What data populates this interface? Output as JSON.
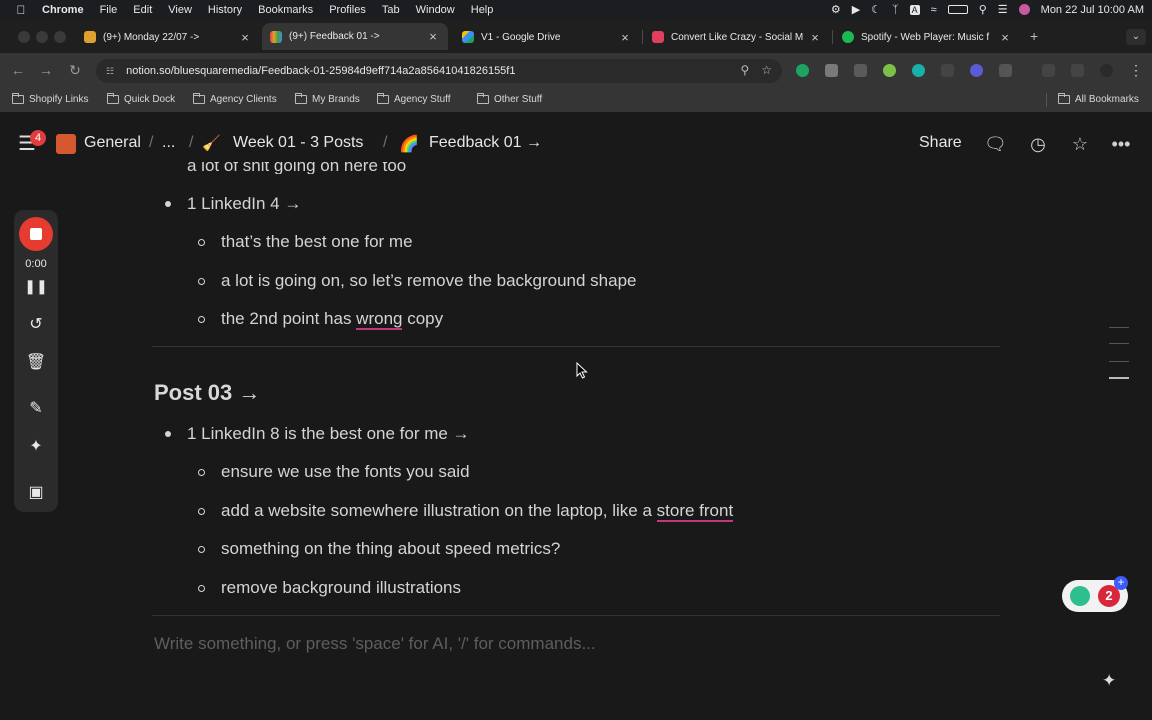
{
  "menubar": {
    "app": "Chrome",
    "items": [
      "File",
      "Edit",
      "View",
      "History",
      "Bookmarks",
      "Profiles",
      "Tab",
      "Window",
      "Help"
    ],
    "clock": "Mon 22 Jul  10:00 AM"
  },
  "tabs": [
    {
      "label": "(9+) Monday 22/07 ->",
      "icon": "trophy-icon",
      "color": "#e0a030"
    },
    {
      "label": "(9+) Feedback 01 ->",
      "icon": "rainbow-icon",
      "color": "#e06040",
      "active": true
    },
    {
      "label": "V1 - Google Drive",
      "icon": "google-drive-icon",
      "color": "#3b8ff0"
    },
    {
      "label": "Convert Like Crazy - Social M",
      "icon": "app-icon",
      "color": "#e04060"
    },
    {
      "label": "Spotify - Web Player: Music f",
      "icon": "spotify-icon",
      "color": "#1db954"
    }
  ],
  "address": {
    "url": "notion.so/bluesquaremedia/Feedback-01-25984d9eff714a2a85641041826155f1"
  },
  "bookmarks": {
    "items": [
      "Shopify Links",
      "Quick Dock",
      "Agency Clients",
      "My Brands",
      "Agency Stuff",
      "Other Stuff"
    ],
    "all": "All Bookmarks"
  },
  "notion": {
    "badge": "4",
    "crumbs": [
      "General",
      "...",
      "Week 01 - 3 Posts",
      "Feedback 01 →"
    ],
    "share": "Share"
  },
  "recorder": {
    "timer": "0:00"
  },
  "content": {
    "cut_line": "a lot of shit going on here too",
    "linkedin4": "1 LinkedIn 4 →",
    "l4_items": [
      {
        "text": "that’s the best one for me"
      },
      {
        "text": "a lot is going on, so let’s remove the background shape"
      },
      {
        "before": "the 2nd point has ",
        "flagged": "wrong",
        "after": " copy"
      }
    ],
    "post03": "Post 03 →",
    "linkedin8": "1 LinkedIn 8 is the best one for me →",
    "l8_items": [
      {
        "text": "ensure we use the fonts you said"
      },
      {
        "before": "add a website somewhere illustration on the laptop, like a ",
        "flagged": "store front"
      },
      {
        "text": "something on the thing about speed metrics?"
      },
      {
        "text": "remove background illustrations"
      }
    ],
    "placeholder": "Write something, or press 'space' for AI, '/' for commands..."
  },
  "widget": {
    "count": "2"
  }
}
